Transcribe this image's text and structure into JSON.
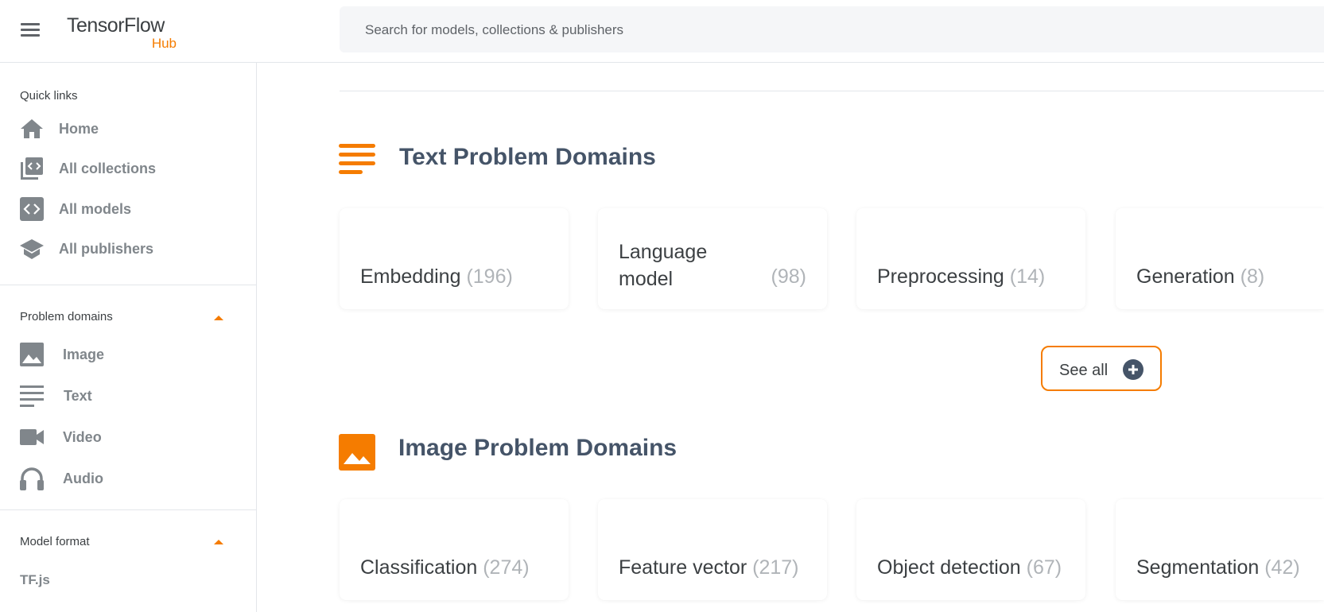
{
  "header": {
    "logo_main": "TensorFlow",
    "logo_sub": "Hub",
    "search_placeholder": "Search for models, collections & publishers"
  },
  "sidebar": {
    "quick_links_heading": "Quick links",
    "quick_links": [
      {
        "label": "Home",
        "icon": "home-icon"
      },
      {
        "label": "All collections",
        "icon": "collections-icon"
      },
      {
        "label": "All models",
        "icon": "models-icon"
      },
      {
        "label": "All publishers",
        "icon": "publishers-icon"
      }
    ],
    "problem_domains_heading": "Problem domains",
    "problem_domains": [
      {
        "label": "Image",
        "icon": "image-icon"
      },
      {
        "label": "Text",
        "icon": "text-icon"
      },
      {
        "label": "Video",
        "icon": "video-icon"
      },
      {
        "label": "Audio",
        "icon": "headphones-icon"
      }
    ],
    "model_format_heading": "Model format",
    "model_formats": [
      {
        "label": "TF.js"
      }
    ]
  },
  "text_section": {
    "title": "Text Problem Domains",
    "cards": [
      {
        "name": "Embedding",
        "count": "(196)"
      },
      {
        "name": "Language model",
        "count": "(98)"
      },
      {
        "name": "Preprocessing",
        "count": "(14)"
      },
      {
        "name": "Generation",
        "count": "(8)"
      }
    ],
    "see_all_label": "See all"
  },
  "image_section": {
    "title": "Image Problem Domains",
    "cards": [
      {
        "name": "Classification",
        "count": "(274)"
      },
      {
        "name": "Feature vector",
        "count": "(217)"
      },
      {
        "name": "Object detection",
        "count": "(67)"
      },
      {
        "name": "Segmentation",
        "count": "(42)"
      }
    ]
  },
  "colors": {
    "accent": "#f57c00",
    "title_text": "#455468",
    "nav_text": "#80868b",
    "count_text": "#b0b4b8"
  }
}
